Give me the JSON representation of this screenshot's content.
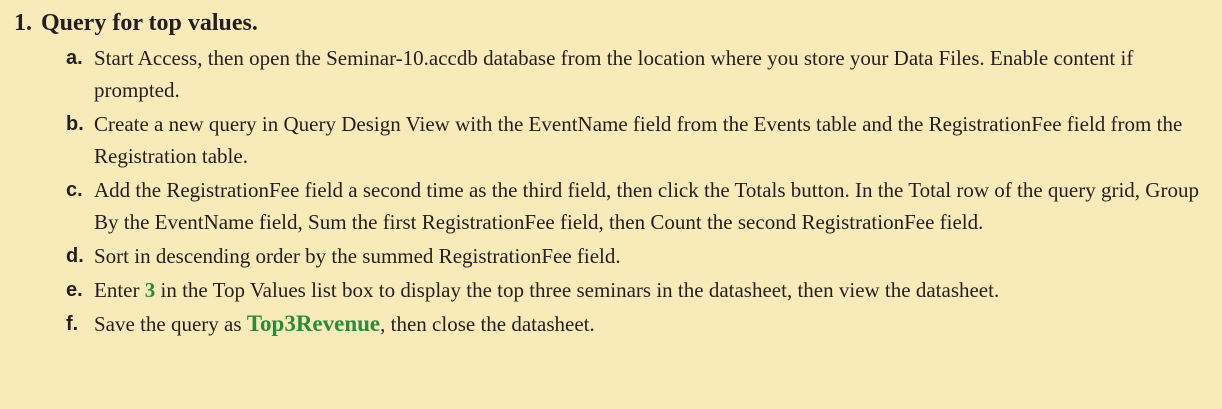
{
  "exercise": {
    "number": "1.",
    "title": "Query for top values."
  },
  "steps": [
    {
      "letter": "a.",
      "text": "Start Access, then open the Seminar-10.accdb database from the location where you store your Data Files. Enable content if prompted."
    },
    {
      "letter": "b.",
      "text": "Create a new query in Query Design View with the EventName field from the Events table and the RegistrationFee field from the Registration table."
    },
    {
      "letter": "c.",
      "text": "Add the RegistrationFee field a second time as the third field, then click the Totals button. In the Total row of the query grid, Group By the EventName field, Sum the first RegistrationFee field, then Count the second RegistrationFee field."
    },
    {
      "letter": "d.",
      "text": "Sort in descending order by the summed RegistrationFee field."
    },
    {
      "letter": "e.",
      "text_before": "Enter ",
      "highlight": "3",
      "text_after": " in the Top Values list box to display the top three seminars in the datasheet, then view the datasheet."
    },
    {
      "letter": "f.",
      "text_before": "Save the query as ",
      "highlight": "Top3Revenue",
      "text_after": ", then close the datasheet."
    }
  ],
  "colors": {
    "background": "#f8ebb9",
    "highlight": "#2c8a3c",
    "text": "#231f20"
  }
}
